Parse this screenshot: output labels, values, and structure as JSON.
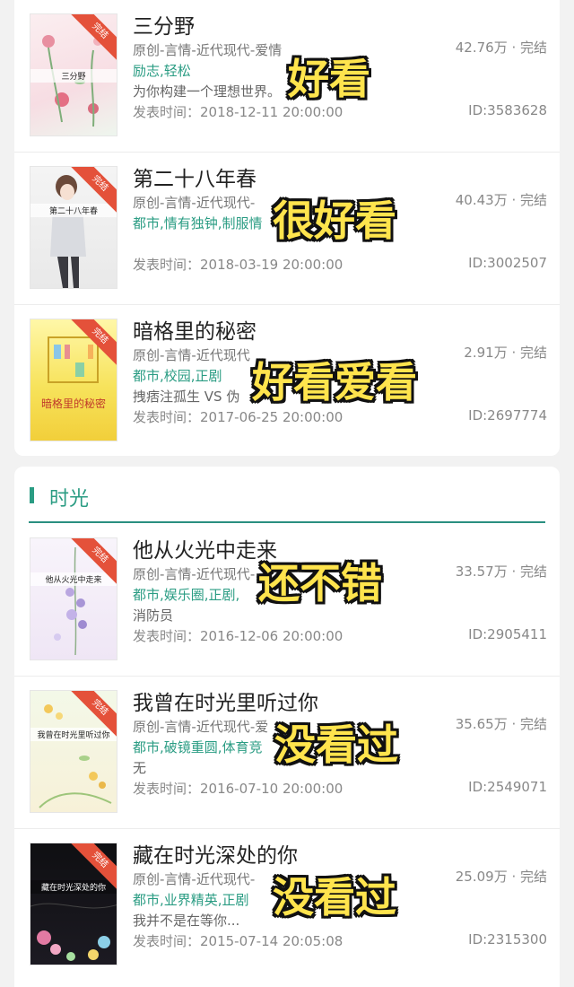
{
  "books_top": [
    {
      "title": "三分野",
      "category": "原创-言情-近代现代-爱情",
      "tags": "励志,轻松",
      "intro": "为你构建一个理想世界。",
      "date": "发表时间：2018-12-11 20:00:00",
      "stat": "42.76万 · 完结",
      "id": "ID:3583628",
      "ribbon": "完结",
      "cover_title": "三分野",
      "overlay": "好看"
    },
    {
      "title": "第二十八年春",
      "category": "原创-言情-近代现代-",
      "tags": "都市,情有独钟,制服情",
      "intro": "",
      "date": "发表时间：2018-03-19 20:00:00",
      "stat": "40.43万 · 完结",
      "id": "ID:3002507",
      "ribbon": "完结",
      "cover_title": "第二十八年春",
      "overlay": "很好看"
    },
    {
      "title": "暗格里的秘密",
      "category": "原创-言情-近代现代",
      "tags": "都市,校园,正剧",
      "intro": "拽痞注孤生 VS 伪",
      "date": "发表时间：2017-06-25 20:00:00",
      "stat": "2.91万 · 完结",
      "id": "ID:2697774",
      "ribbon": "完结",
      "cover_title": "暗格里的秘密",
      "overlay": "好看爱看"
    }
  ],
  "section": {
    "title": "时光"
  },
  "books_bottom": [
    {
      "title": "他从火光中走来",
      "category": "原创-言情-近代现代-",
      "tags": "都市,娱乐圈,正剧,",
      "intro": "消防员",
      "date": "发表时间：2016-12-06 20:00:00",
      "stat": "33.57万 · 完结",
      "id": "ID:2905411",
      "ribbon": "完结",
      "cover_title": "他从火光中走来",
      "overlay": "还不错"
    },
    {
      "title": "我曾在时光里听过你",
      "category": "原创-言情-近代现代-爱",
      "tags": "都市,破镜重圆,体育竞",
      "intro": "无",
      "date": "发表时间：2016-07-10 20:00:00",
      "stat": "35.65万 · 完结",
      "id": "ID:2549071",
      "ribbon": "完结",
      "cover_title": "我曾在时光里听过你",
      "overlay": "没看过"
    },
    {
      "title": "藏在时光深处的你",
      "category": "原创-言情-近代现代-",
      "tags": "都市,业界精英,正剧",
      "intro": "我并不是在等你...",
      "date": "发表时间：2015-07-14 20:05:08",
      "stat": "25.09万 · 完结",
      "id": "ID:2315300",
      "ribbon": "完结",
      "cover_title": "藏在时光深处的你",
      "overlay": "没看过"
    }
  ],
  "colors": {
    "accent": "#2a9c83",
    "ribbon": "#e4513a",
    "overlay_text": "#ffe44d"
  }
}
